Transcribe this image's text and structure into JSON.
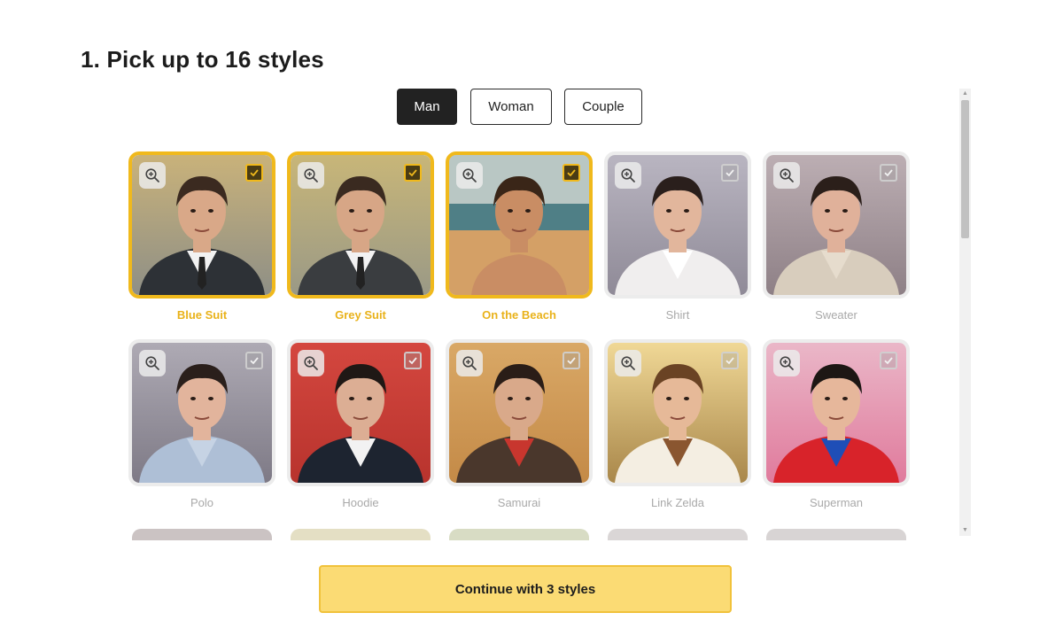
{
  "page": {
    "title": "1. Pick up to 16 styles"
  },
  "gender_tabs": [
    {
      "label": "Man",
      "active": true
    },
    {
      "label": "Woman",
      "active": false
    },
    {
      "label": "Couple",
      "active": false
    }
  ],
  "icons": {
    "zoom": "zoom-in-icon",
    "check": "checkbox-check-icon"
  },
  "colors": {
    "selected_accent": "#f0b91c",
    "button_fill": "#fbdb74",
    "active_tab": "#222222"
  },
  "styles": [
    {
      "label": "Blue Suit",
      "selected": true
    },
    {
      "label": "Grey Suit",
      "selected": true
    },
    {
      "label": "On the Beach",
      "selected": true
    },
    {
      "label": "Shirt",
      "selected": false
    },
    {
      "label": "Sweater",
      "selected": false
    },
    {
      "label": "Polo",
      "selected": false
    },
    {
      "label": "Hoodie",
      "selected": false
    },
    {
      "label": "Samurai",
      "selected": false
    },
    {
      "label": "Link Zelda",
      "selected": false
    },
    {
      "label": "Superman",
      "selected": false
    }
  ],
  "continue_button": {
    "label": "Continue with 3 styles"
  }
}
